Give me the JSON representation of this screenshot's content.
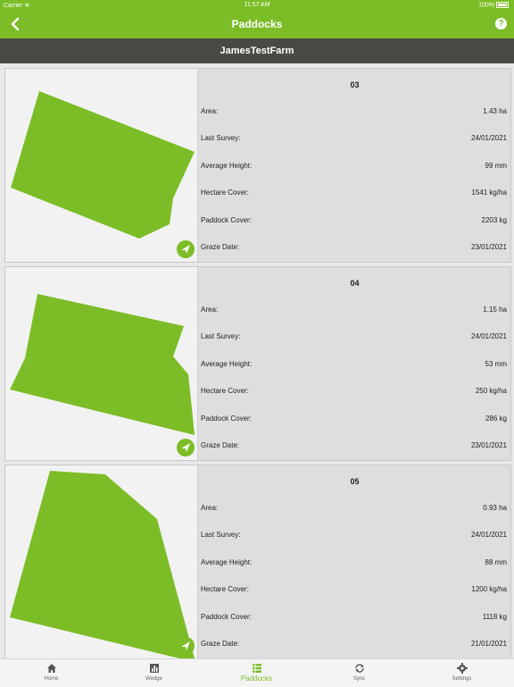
{
  "status_bar": {
    "carrier": "Carrier",
    "time": "11:57 AM",
    "battery": "100%"
  },
  "nav": {
    "title": "Paddocks"
  },
  "farm_name": "JamesTestFarm",
  "field_labels": {
    "area": "Area:",
    "last_survey": "Last Survey:",
    "average_height": "Average Height:",
    "hectare_cover": "Hectare Cover:",
    "paddock_cover": "Paddock Cover:",
    "graze_date": "Graze Date:"
  },
  "paddocks": [
    {
      "number": "03",
      "area": "1.43 ha",
      "last_survey": "24/01/2021",
      "average_height": "99 mm",
      "hectare_cover": "1541 kg/ha",
      "paddock_cover": "2203 kg",
      "graze_date": "23/01/2021"
    },
    {
      "number": "04",
      "area": "1.15 ha",
      "last_survey": "24/01/2021",
      "average_height": "53 mm",
      "hectare_cover": "250 kg/ha",
      "paddock_cover": "286 kg",
      "graze_date": "23/01/2021"
    },
    {
      "number": "05",
      "area": "0.93 ha",
      "last_survey": "24/01/2021",
      "average_height": "88 mm",
      "hectare_cover": "1200 kg/ha",
      "paddock_cover": "1118 kg",
      "graze_date": "21/01/2021"
    }
  ],
  "tabs": [
    {
      "label": "Home",
      "icon": "home-icon"
    },
    {
      "label": "Wedge",
      "icon": "bar-chart-icon"
    },
    {
      "label": "Paddocks",
      "icon": "list-icon",
      "active": true
    },
    {
      "label": "Sync",
      "icon": "sync-icon"
    },
    {
      "label": "Settings",
      "icon": "gear-icon"
    }
  ],
  "colors": {
    "accent": "#7cbd27",
    "header_dark": "#4a4a44",
    "card_bg": "#dedede"
  }
}
